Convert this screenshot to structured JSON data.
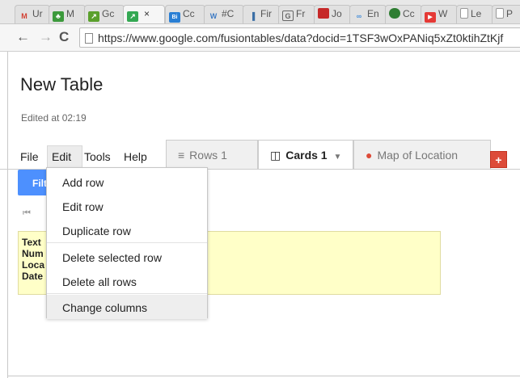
{
  "browser": {
    "tabs": [
      {
        "label": "Ur",
        "icon": "gmail-icon",
        "color": "#d23f31",
        "glyph": "M"
      },
      {
        "label": "M",
        "icon": "people-icon",
        "color": "#3c9a3c",
        "glyph": "♣"
      },
      {
        "label": "Gc",
        "icon": "trend-icon",
        "color": "#5aa02c",
        "glyph": "↗"
      },
      {
        "label": "×",
        "icon": "fusion-tables-icon",
        "color": "#34a853",
        "glyph": "↗",
        "active": true
      },
      {
        "label": "Cc",
        "icon": "bin-icon",
        "color": "#2a7fd4",
        "glyph": "Bi"
      },
      {
        "label": "#C",
        "icon": "wordpress-icon",
        "color": "#3e7bc4",
        "glyph": "W"
      },
      {
        "label": "Fir",
        "icon": "chart-icon",
        "color": "#3a6ea5",
        "glyph": "▐"
      },
      {
        "label": "Fr",
        "icon": "doc-icon",
        "color": "#666666",
        "glyph": "G"
      },
      {
        "label": "Jo",
        "icon": "flag-icon",
        "color": "#c62828",
        "glyph": "▬"
      },
      {
        "label": "En",
        "icon": "link-icon",
        "color": "#4a90d9",
        "glyph": "∞"
      },
      {
        "label": "Cc",
        "icon": "globe-icon",
        "color": "#2e7d32",
        "glyph": "●"
      },
      {
        "label": "W",
        "icon": "youtube-icon",
        "color": "#e53935",
        "glyph": "▶"
      },
      {
        "label": "Le",
        "icon": "page-icon",
        "color": "#aaaaaa",
        "glyph": ""
      },
      {
        "label": "P",
        "icon": "page-icon",
        "color": "#aaaaaa",
        "glyph": ""
      }
    ],
    "url": "https://www.google.com/fusiontables/data?docid=1TSF3wOxPANiq5xZt0ktihZtKjf"
  },
  "page": {
    "title": "New Table",
    "edited": "Edited at 02:19"
  },
  "menu": {
    "file": "File",
    "edit": "Edit",
    "tools": "Tools",
    "help": "Help"
  },
  "view_tabs": {
    "rows": "Rows 1",
    "cards": "Cards 1",
    "map": "Map of Location",
    "add": "+"
  },
  "filter_label": "Filt",
  "card_lines": [
    "Text",
    "Num",
    "Loca",
    "Date"
  ],
  "edit_menu": {
    "items": [
      "Add row",
      "Edit row",
      "Duplicate row",
      "Delete selected row",
      "Delete all rows",
      "Change columns"
    ],
    "highlighted": "Change columns"
  },
  "colors": {
    "accent_blue": "#4d90fe",
    "add_tab_red": "#dd4b39",
    "card_yellow": "#ffffc8"
  }
}
